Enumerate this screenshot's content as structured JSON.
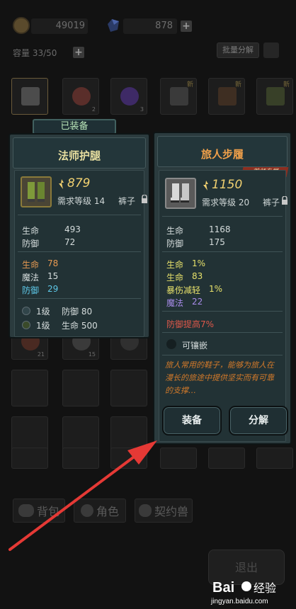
{
  "resources": {
    "gold": "49019",
    "gems": "878"
  },
  "inventory": {
    "capacity": "容量 33/50",
    "bulk_decompose": "批量分解",
    "slots": [
      {
        "count": "",
        "badge": ""
      },
      {
        "count": "2",
        "badge": ""
      },
      {
        "count": "3",
        "badge": ""
      },
      {
        "count": "",
        "badge": "新"
      },
      {
        "count": "",
        "badge": "新"
      },
      {
        "count": "",
        "badge": "新"
      }
    ],
    "row2": [
      {
        "count": "21"
      },
      {
        "count": "15"
      },
      {
        "count": ""
      }
    ]
  },
  "equipped_tag": "已装备",
  "left_panel": {
    "title": "法师护腿",
    "score": "879",
    "req_level": "需求等级 14",
    "slot_type": "裤子",
    "base_stats": [
      {
        "label": "生命",
        "value": "493"
      },
      {
        "label": "防御",
        "value": "72"
      }
    ],
    "bonus_stats": [
      {
        "label": "生命",
        "value": "78",
        "color": "#e79a52"
      },
      {
        "label": "魔法",
        "value": "15",
        "color": "#e8e8e8"
      },
      {
        "label": "防御",
        "value": "29",
        "color": "#5ec8e8"
      }
    ],
    "gems": [
      {
        "level": "1级",
        "stat": "防御 80"
      },
      {
        "level": "1级",
        "stat": "生命 500"
      }
    ]
  },
  "right_panel": {
    "title": "旅人步履",
    "badge": "首领专属",
    "score": "1150",
    "req_level": "需求等级 20",
    "slot_type": "裤子",
    "base_stats": [
      {
        "label": "生命",
        "value": "1168"
      },
      {
        "label": "防御",
        "value": "175"
      }
    ],
    "bonus_stats": [
      {
        "label": "生命",
        "value": "1%",
        "color": "#e6e06a"
      },
      {
        "label": "生命",
        "value": "83",
        "color": "#e6e06a"
      },
      {
        "label": "暴伤减轻",
        "value": "1%",
        "color": "#e6e06a"
      },
      {
        "label": "魔法",
        "value": "22",
        "color": "#a78be8"
      }
    ],
    "special": "防御提高7%",
    "socket": "可镶嵌",
    "description": [
      "旅人常用的鞋子，能够为旅人在",
      "漫长的旅途中提供坚实而有可靠",
      "的支撑…"
    ],
    "equip_button": "装备",
    "decompose_button": "分解"
  },
  "tabs": {
    "bag": "背包",
    "character": "角色",
    "pet": "契约兽"
  },
  "exit_button": "退出",
  "watermark": {
    "brand": "Bai",
    "brand2": "经验",
    "url": "jingyan.baidu.com"
  },
  "colors": {
    "title_left": "#e8dfa0",
    "title_right": "#f0a04a",
    "arrow": "#e53935",
    "panel_bg": "#2b3b3e"
  }
}
